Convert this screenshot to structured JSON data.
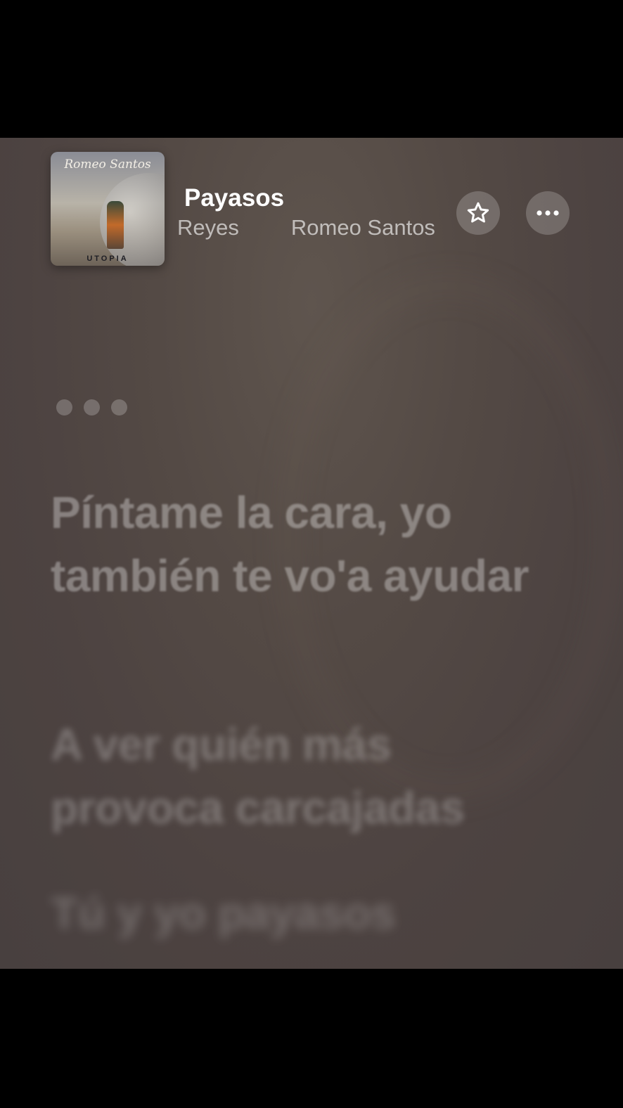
{
  "now_playing": {
    "title": "Payasos",
    "artists": [
      "Reyes",
      "Romeo Santos"
    ],
    "album_art": {
      "script_text": "Romeo Santos",
      "footer_text": "UTOPIA"
    }
  },
  "actions": {
    "favorite_icon": "star-icon",
    "more_icon": "ellipsis-icon"
  },
  "lyrics": {
    "lines": [
      "Píntame la cara, yo también te vo'a ayudar",
      "A ver quién más provoca carcajadas",
      "Tú y yo payasos"
    ]
  },
  "colors": {
    "background": "#544a45",
    "title": "#ffffff"
  }
}
